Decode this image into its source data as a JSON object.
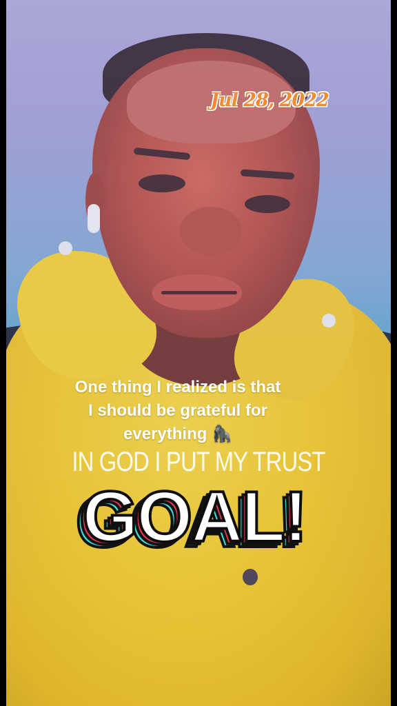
{
  "date_sticker": "Jul 28, 2022",
  "caption": {
    "line1": "One thing I realized is that",
    "line2": "I should be grateful for",
    "line3": "everything 🦍"
  },
  "headline": "IN GOD I PUT MY TRUST",
  "goal_sticker": "GOAL!",
  "colors": {
    "date": "#f08a33",
    "goal_fill": "#ffffff",
    "goal_shadow_cyan": "#3fe0d6",
    "goal_shadow_red": "#e0334e",
    "jacket": "#f1c823",
    "background": "#4aa3c9"
  }
}
